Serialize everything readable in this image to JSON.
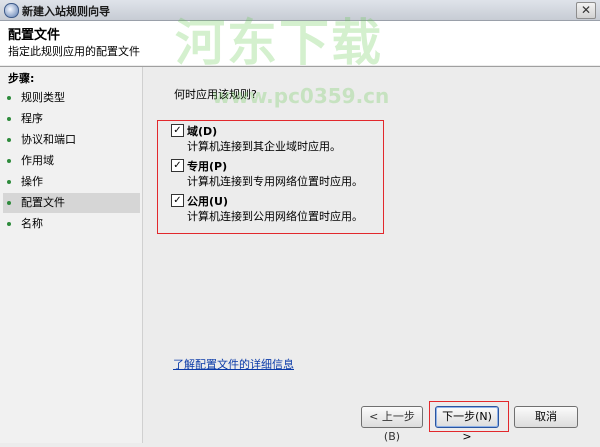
{
  "window": {
    "title": "新建入站规则向导",
    "close_glyph": "✕"
  },
  "header": {
    "title": "配置文件",
    "subtitle": "指定此规则应用的配置文件"
  },
  "steps": {
    "label": "步骤:",
    "items": [
      {
        "label": "规则类型"
      },
      {
        "label": "程序"
      },
      {
        "label": "协议和端口"
      },
      {
        "label": "作用域"
      },
      {
        "label": "操作"
      },
      {
        "label": "配置文件",
        "current": true
      },
      {
        "label": "名称"
      }
    ]
  },
  "main": {
    "question": "何时应用该规则?",
    "options": [
      {
        "label": "域(D)",
        "desc": "计算机连接到其企业域时应用。",
        "checked": true
      },
      {
        "label": "专用(P)",
        "desc": "计算机连接到专用网络位置时应用。",
        "checked": true
      },
      {
        "label": "公用(U)",
        "desc": "计算机连接到公用网络位置时应用。",
        "checked": true
      }
    ],
    "link": "了解配置文件的详细信息"
  },
  "buttons": {
    "prev": "< 上一步(B)",
    "next": "下一步(N) >",
    "cancel": "取消"
  },
  "watermark": {
    "main": "河东下载",
    "url": "www.pc0359.cn"
  }
}
